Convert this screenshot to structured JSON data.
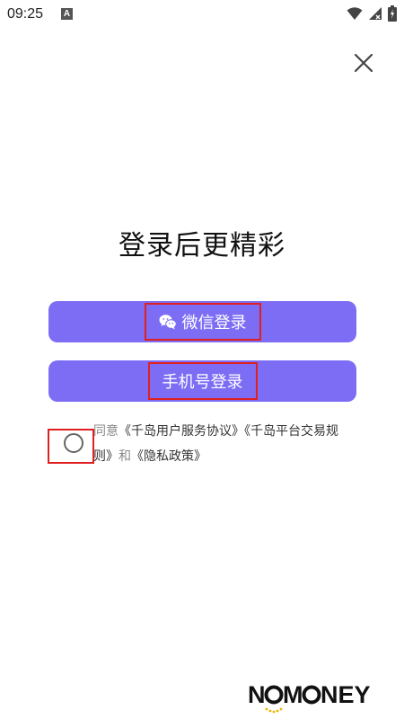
{
  "status_bar": {
    "time": "09:25",
    "notification_badge": "A"
  },
  "close_icon": "close-icon",
  "title": "登录后更精彩",
  "buttons": {
    "wechat": {
      "label": "微信登录",
      "icon": "wechat-icon"
    },
    "phone": {
      "label": "手机号登录"
    }
  },
  "agreement": {
    "prefix": "同意",
    "link1": "《千岛用户服务协议》",
    "link2": "《千岛平台交易规则》",
    "and": "和",
    "link3": "《隐私政策》"
  },
  "watermark": {
    "text": "NOMONEY"
  },
  "colors": {
    "primary": "#7d6df5",
    "highlight_box": "#e02020"
  }
}
